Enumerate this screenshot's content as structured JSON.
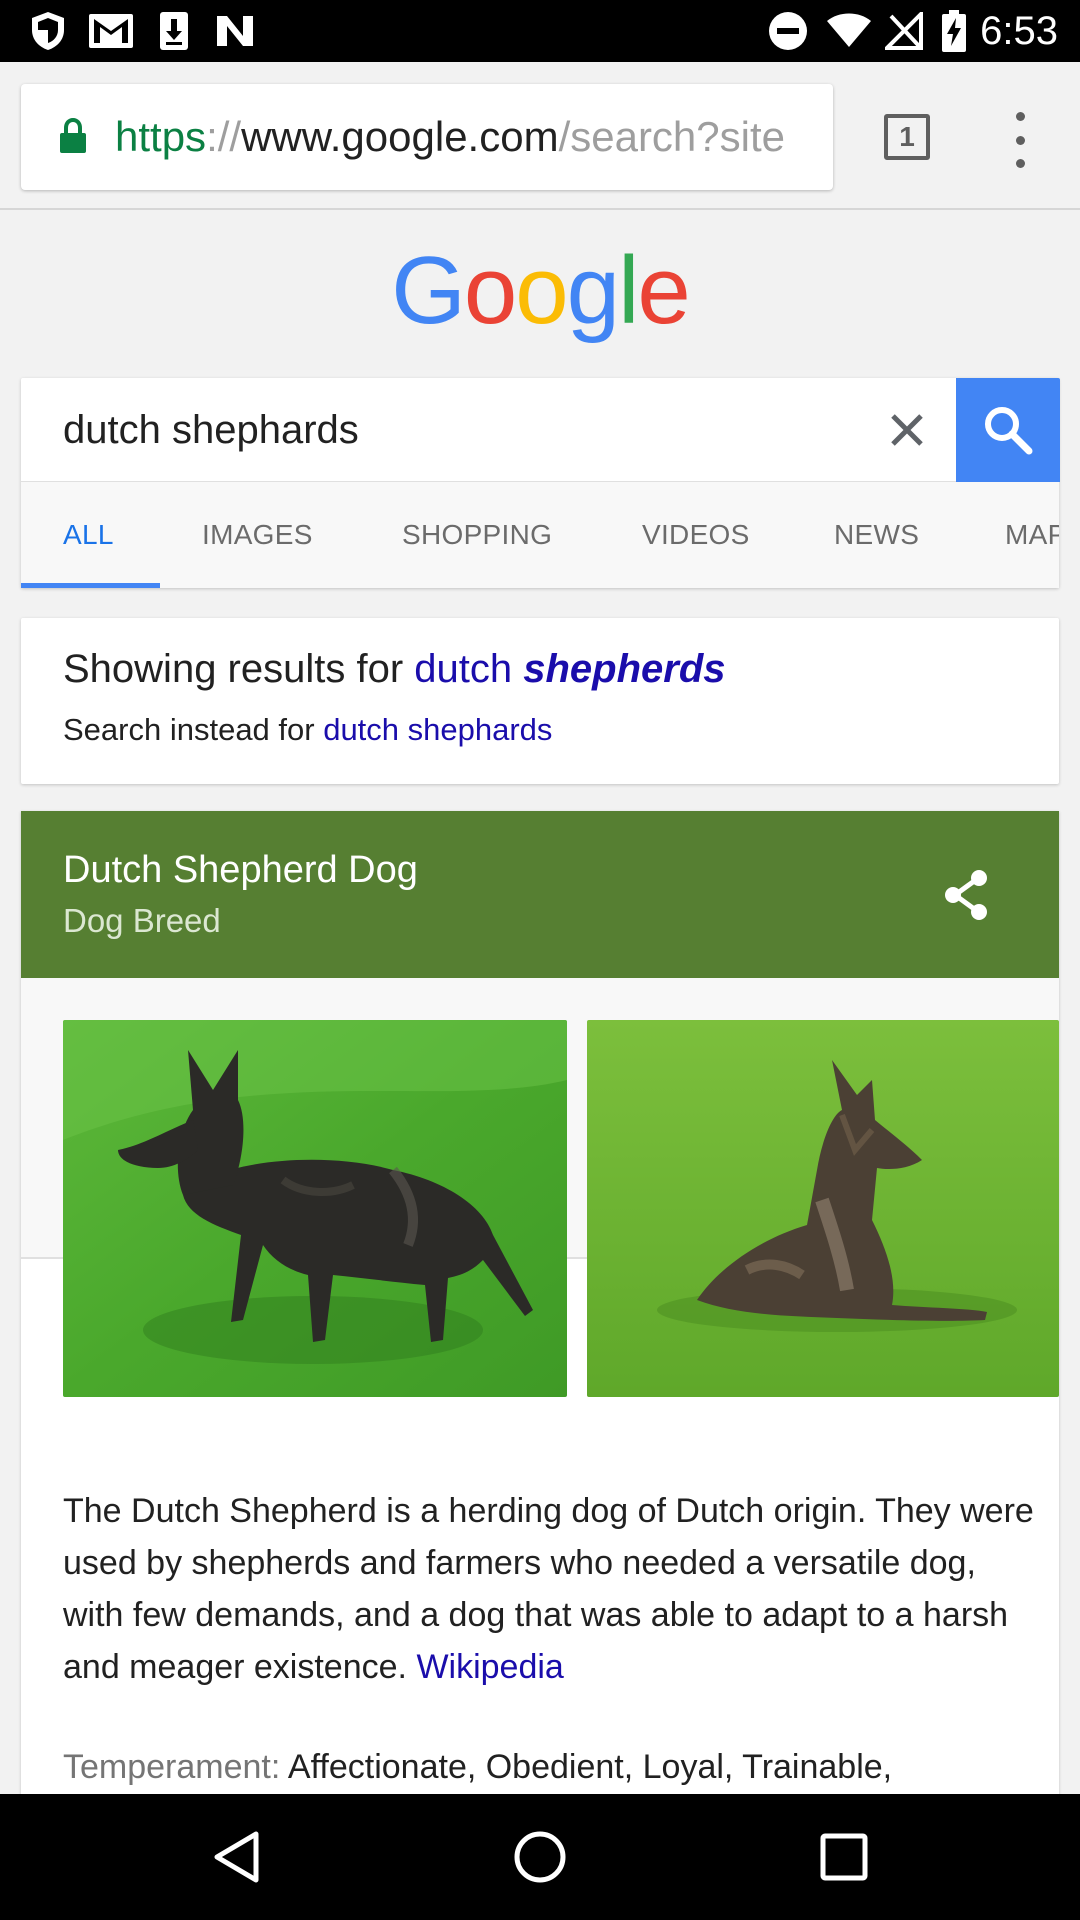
{
  "status_bar": {
    "time": "6:53",
    "left_icons": [
      "shield-icon",
      "gmail-icon",
      "download-icon",
      "n-app-icon"
    ],
    "right_icons": [
      "do-not-disturb-icon",
      "wifi-icon",
      "no-signal-icon",
      "battery-charging-icon"
    ]
  },
  "browser": {
    "url_scheme": "https",
    "url_sep": "://",
    "url_host": "www.google.com",
    "url_path": "/search?site",
    "tab_count": "1",
    "lock_color": "#0b8043"
  },
  "google_logo": {
    "letters": [
      "G",
      "o",
      "o",
      "g",
      "l",
      "e"
    ]
  },
  "search": {
    "query": "dutch shephards",
    "button_color": "#4285f4"
  },
  "tabs": [
    "ALL",
    "IMAGES",
    "SHOPPING",
    "VIDEOS",
    "NEWS",
    "MAPS"
  ],
  "active_tab": "ALL",
  "spell": {
    "showing_prefix": "Showing results for ",
    "corrected_plain": "dutch ",
    "corrected_bold": "shepherds",
    "instead_prefix": "Search instead for ",
    "instead_query": "dutch shephards"
  },
  "knowledge_panel": {
    "title": "Dutch Shepherd Dog",
    "subtitle": "Dog Breed",
    "header_color": "#567f32",
    "description": "The Dutch Shepherd is a herding dog of Dutch origin. They were used by shepherds and farmers who needed a versatile dog, with few demands, and a dog that was able to adapt to a harsh and meager existence. ",
    "source": "Wikipedia",
    "temperament_label": "Temperament:",
    "temperament_value": " Affectionate, Obedient, Loyal, Trainable,"
  }
}
